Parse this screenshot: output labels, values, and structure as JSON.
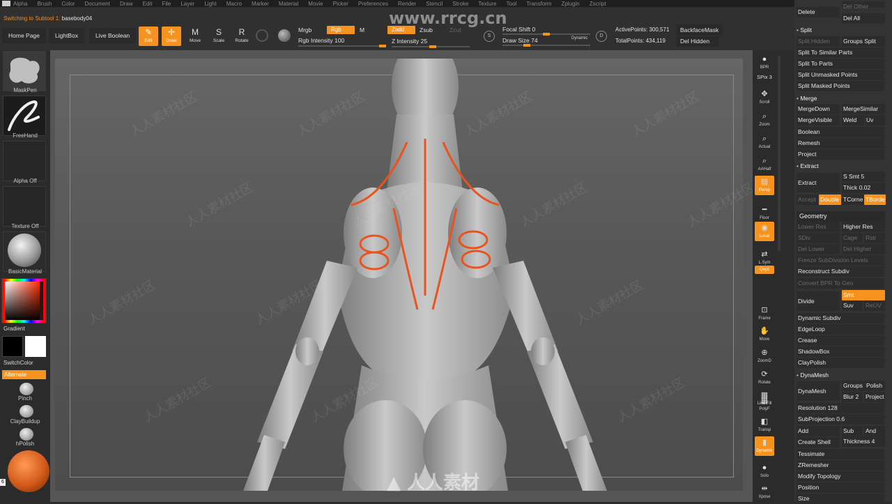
{
  "menubar": [
    "Alpha",
    "Brush",
    "Color",
    "Document",
    "Draw",
    "Edit",
    "File",
    "Layer",
    "Light",
    "Macro",
    "Marker",
    "Material",
    "Movie",
    "Picker",
    "Preferences",
    "Render",
    "Stencil",
    "Stroke",
    "Texture",
    "Tool",
    "Transform",
    "Zplugin",
    "Zscript"
  ],
  "subtool": {
    "key": "Switching to Subtool 1:",
    "value": "basebody04"
  },
  "top": {
    "home_page": "Home Page",
    "lightbox": "LightBox",
    "live_boolean": "Live Boolean",
    "tools": [
      {
        "label": "Edit",
        "icon": "edit-icon",
        "glyph": "✎",
        "active": true
      },
      {
        "label": "Draw",
        "icon": "draw-icon",
        "glyph": "✢",
        "active": true
      },
      {
        "label": "Move",
        "icon": "move-icon",
        "glyph": "M",
        "active": false
      },
      {
        "label": "Scale",
        "icon": "scale-icon",
        "glyph": "S",
        "active": false
      },
      {
        "label": "Rotate",
        "icon": "rotate-icon",
        "glyph": "R",
        "active": false
      }
    ],
    "mrgb": "Mrgb",
    "rgb": "Rgb",
    "m": "M",
    "rgb_intensity_label": "Rgb Intensity",
    "rgb_intensity": "100",
    "zadd": "Zadd",
    "zsub": "Zsub",
    "zcut": "Zcut",
    "z_intensity_label": "Z Intensity",
    "z_intensity": "25",
    "focal_shift_label": "Focal Shift",
    "focal_shift": "0",
    "draw_size_label": "Draw Size",
    "draw_size": "74",
    "dynamic": "Dynamic",
    "active_points_label": "ActivePoints:",
    "active_points": "300,571",
    "total_points_label": "TotalPoints:",
    "total_points": "434,119",
    "backface_mask": "BackfaceMask",
    "del_hidden": "Del Hidden"
  },
  "left": {
    "brush": "MaskPen",
    "stroke": "FreeHand",
    "alpha": "Alpha Off",
    "texture": "Texture Off",
    "material": "BasicMaterial",
    "gradient": "Gradient",
    "switch_color": "SwitchColor",
    "alternate": "Alternate",
    "brushes": [
      "Pinch",
      "ClayBuildup",
      "hPolish"
    ],
    "index": "6"
  },
  "right": {
    "spix_label": "SPix",
    "spix": "3",
    "buttons": [
      {
        "label": "BPR",
        "icon": "bpr-icon",
        "glyph": "●"
      },
      {
        "label": "Scroll",
        "icon": "scroll-icon",
        "glyph": "✥"
      },
      {
        "label": "Zoom",
        "icon": "zoom-icon",
        "glyph": "⌕"
      },
      {
        "label": "Actual",
        "icon": "actual-icon",
        "glyph": "⌕"
      },
      {
        "label": "AAHalf",
        "icon": "aahalf-icon",
        "glyph": "⌕"
      },
      {
        "label": "Persp",
        "icon": "persp-icon",
        "glyph": "▤"
      },
      {
        "label": "Floor",
        "icon": "floor-icon",
        "glyph": "━"
      },
      {
        "label": "Local",
        "icon": "local-icon",
        "glyph": "◉"
      },
      {
        "label": "L.Sym",
        "icon": "lsym-icon",
        "glyph": "⇄"
      },
      {
        "label": "Qxyz",
        "icon": "xyz-icon",
        "glyph": "xyz"
      },
      {
        "label": "Frame",
        "icon": "frame-icon",
        "glyph": "⊡"
      },
      {
        "label": "Move",
        "icon": "move-view-icon",
        "glyph": "✋"
      },
      {
        "label": "ZoomD",
        "icon": "zoom3d-icon",
        "glyph": "⊕"
      },
      {
        "label": "Rotate",
        "icon": "rotate-view-icon",
        "glyph": "⟳"
      },
      {
        "label": "Line Fill",
        "icon": "linefill-icon",
        "glyph": "▦"
      },
      {
        "label": "PolyF",
        "icon": "polyf-icon",
        "glyph": "▦"
      },
      {
        "label": "Transp",
        "icon": "transp-icon",
        "glyph": "◧"
      },
      {
        "label": "Dynamic",
        "icon": "dynamic-icon",
        "glyph": "▮"
      },
      {
        "label": "Solo",
        "icon": "solo-icon",
        "glyph": "●"
      },
      {
        "label": "Xpose",
        "icon": "xpose-icon",
        "glyph": "⇹"
      }
    ]
  },
  "palette": {
    "delete": "Delete",
    "del_other": "Del Other",
    "del_all": "Del All",
    "split": "Split",
    "split_hidden": "Split Hidden",
    "groups_split": "Groups Split",
    "split_similar": "Split To Similar Parts",
    "split_parts": "Split To Parts",
    "split_unmasked": "Split Unmasked Points",
    "split_masked": "Split Masked Points",
    "merge": "Merge",
    "merge_down": "MergeDown",
    "merge_similar": "MergeSimilar",
    "merge_visible": "MergeVisible",
    "weld": "Weld",
    "uv": "Uv",
    "boolean": "Boolean",
    "remesh": "Remesh",
    "project": "Project",
    "extract_section": "Extract",
    "extract": "Extract",
    "s_smt_label": "S Smt",
    "s_smt": "5",
    "thick_label": "Thick",
    "thick": "0.02",
    "accept": "Accept",
    "double": "Double",
    "tcorne": "TCorne",
    "tborde": "TBorde",
    "geometry": "Geometry",
    "lower_res": "Lower Res",
    "higher_res": "Higher Res",
    "sdiv": "SDiv",
    "cage": "Cage",
    "rstr": "Rstr",
    "del_lower": "Del Lower",
    "del_higher": "Del Higher",
    "freeze": "Freeze SubDivision Levels",
    "reconstruct": "Reconstruct Subdiv",
    "convert_bpr": "Convert BPR To Geo",
    "divide": "Divide",
    "smt": "Smt",
    "suv": "Suv",
    "reuv": "ReUV",
    "dynamic_subdiv": "Dynamic Subdiv",
    "edgeloop": "EdgeLoop",
    "crease": "Crease",
    "shadowbox": "ShadowBox",
    "claypolish": "ClayPolish",
    "dynamesh_section": "DynaMesh",
    "dynamesh": "DynaMesh",
    "groups": "Groups",
    "polish": "Polish",
    "blur_label": "Blur",
    "blur": "2",
    "project2": "Project",
    "resolution_label": "Resolution",
    "resolution": "128",
    "subprojection_label": "SubProjection",
    "subprojection": "0.6",
    "add": "Add",
    "sub": "Sub",
    "and": "And",
    "create_shell": "Create Shell",
    "thickness_label": "Thickness",
    "thickness": "4",
    "tessimate": "Tessimate",
    "zremesher": "ZRemesher",
    "modify_topology": "Modify Topology",
    "position": "Position",
    "size": "Size"
  },
  "watermark": {
    "site": "www.rrcg.cn",
    "brand": "人人素材",
    "tile": "人人素材社区"
  }
}
